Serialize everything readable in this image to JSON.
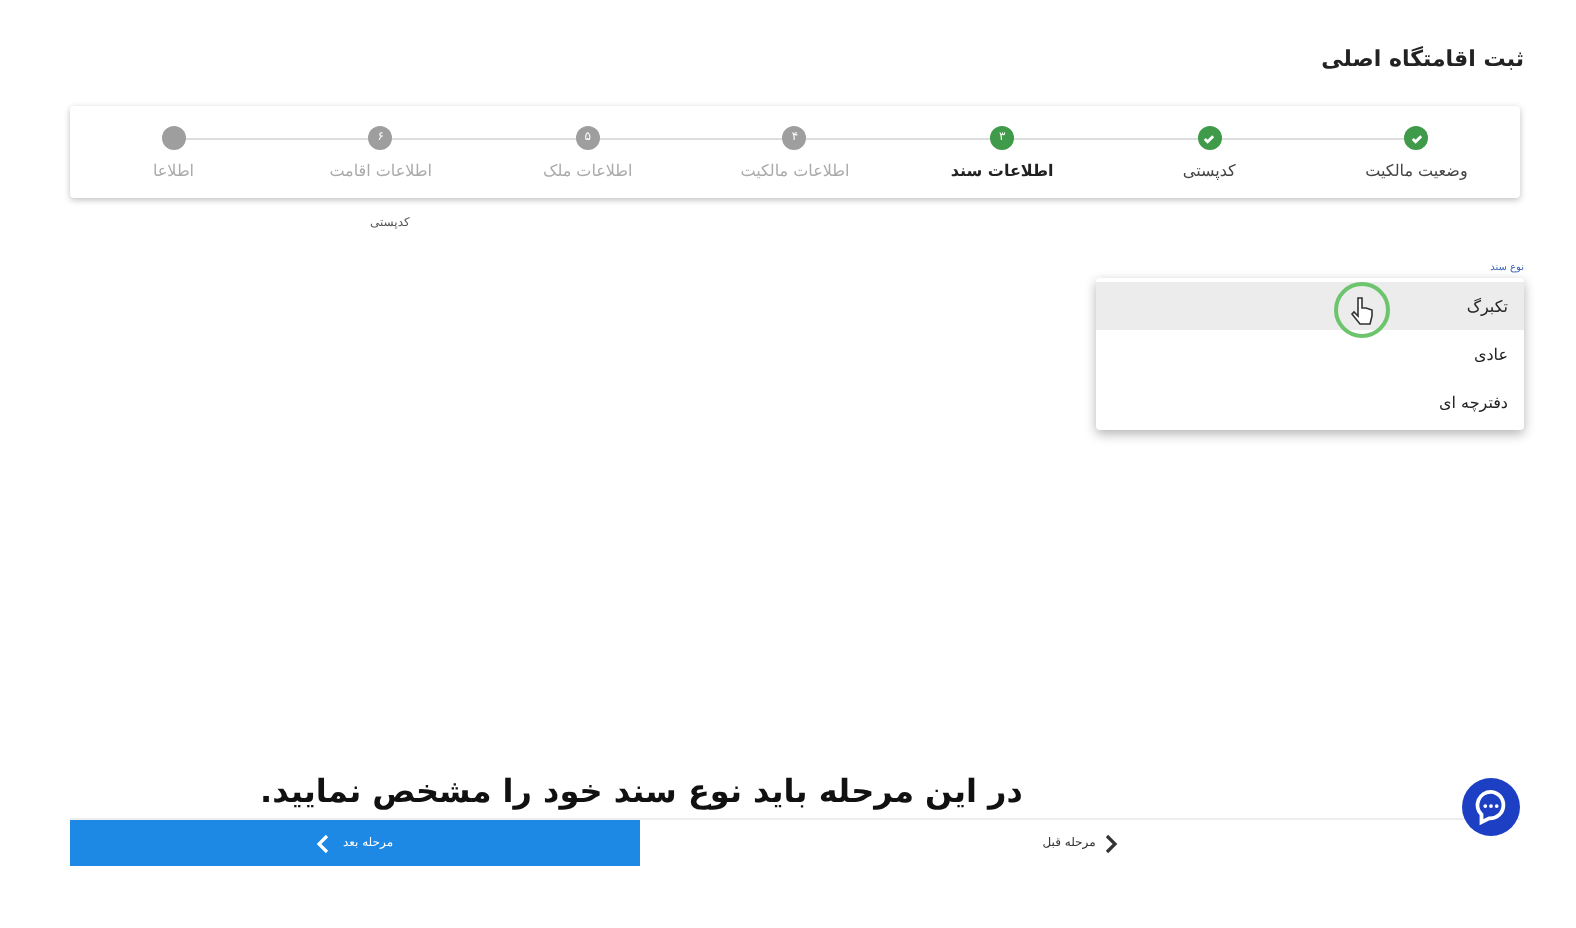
{
  "page_title": "ثبت اقامتگاه اصلی",
  "steps": [
    {
      "label": "وضعیت مالکیت",
      "kind": "done"
    },
    {
      "label": "کدپستی",
      "kind": "done"
    },
    {
      "label": "اطلاعات سند",
      "kind": "active",
      "number": "۳"
    },
    {
      "label": "اطلاعات مالکیت",
      "kind": "pending",
      "number": "۴"
    },
    {
      "label": "اطلاعات ملک",
      "kind": "pending",
      "number": "۵"
    },
    {
      "label": "اطلاعات اقامت",
      "kind": "pending",
      "number": "۶"
    },
    {
      "label": "اطلاعا",
      "kind": "pending"
    }
  ],
  "postal_code": {
    "label": "کدپستی"
  },
  "document_type": {
    "label": "نوع سند",
    "options": [
      {
        "label": "تکبرگ",
        "selected": true
      },
      {
        "label": "عادی",
        "selected": false
      },
      {
        "label": "دفترچه ای",
        "selected": false
      }
    ]
  },
  "caption": "در این مرحله باید نوع سند خود را مشخص نمایید.",
  "footer": {
    "next": "مرحله بعد",
    "previous": "مرحله قبل"
  }
}
